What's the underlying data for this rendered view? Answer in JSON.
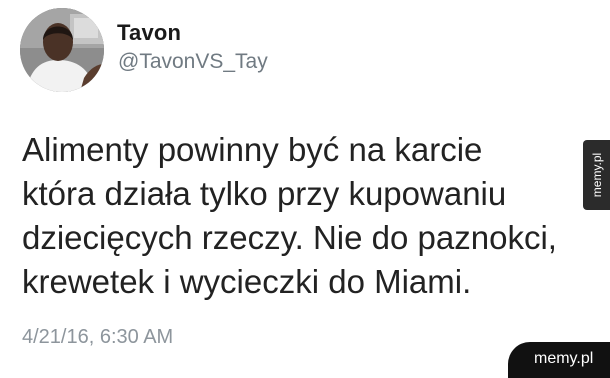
{
  "tweet": {
    "display_name": "Tavon",
    "handle": "@TavonVS_Tay",
    "text_lines": [
      "Alimenty powinny być na karcie",
      "która działa tylko przy kupowaniu",
      "dziecięcych rzeczy. Nie do paznokci,",
      "krewetek i wycieczki do Miami."
    ],
    "timestamp": "4/21/16, 6:30 AM"
  },
  "watermarks": {
    "side": "memy.pl",
    "corner": "memy.pl"
  }
}
